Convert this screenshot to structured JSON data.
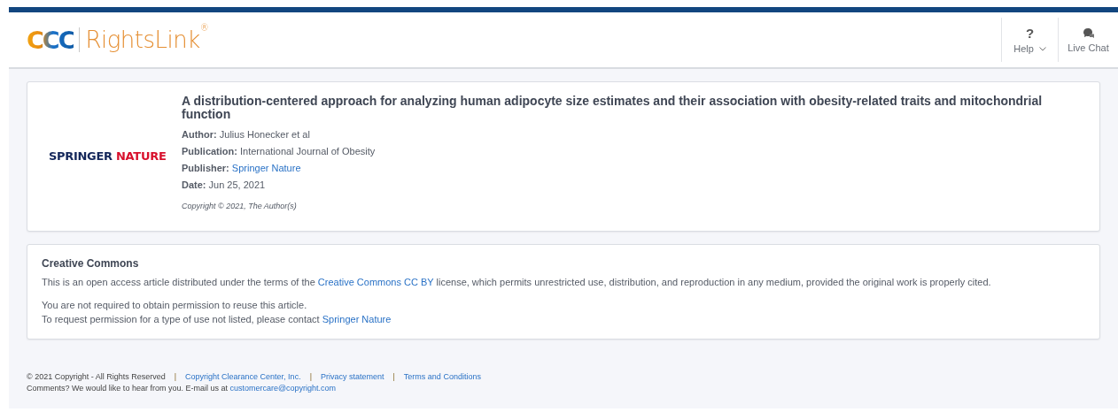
{
  "header": {
    "logo_mark": "CCC",
    "logo_text": "RightsLink",
    "logo_reg": "®",
    "actions": [
      {
        "kind": "help",
        "label": "Help",
        "icon_text": "?"
      },
      {
        "kind": "chat",
        "label": "Live Chat"
      }
    ]
  },
  "article": {
    "publisher_logo": [
      "SPRINGER",
      "NATURE"
    ],
    "title": "A distribution-centered approach for analyzing human adipocyte size estimates and their association with obesity-related traits and mitochondrial function",
    "fields": [
      {
        "label": "Author:",
        "value": "Julius Honecker et al",
        "link": false
      },
      {
        "label": "Publication:",
        "value": "International Journal of Obesity",
        "link": false
      },
      {
        "label": "Publisher:",
        "value": "Springer Nature",
        "link": true
      },
      {
        "label": "Date:",
        "value": "Jun 25, 2021",
        "link": false
      }
    ],
    "copyright": "Copyright © 2021, The Author(s)"
  },
  "license": {
    "heading": "Creative Commons",
    "paragraphs": [
      {
        "before": "This is an open access article distributed under the terms of the ",
        "link": "Creative Commons CC BY",
        "after": " license, which permits unrestricted use, distribution, and reproduction in any medium, provided the original work is properly cited."
      },
      {
        "before": "You are not required to obtain permission to reuse this article."
      },
      {
        "before": "To request permission for a type of use not listed, please contact ",
        "link": "Springer Nature"
      }
    ]
  },
  "footer": {
    "copyright": "© 2021 Copyright - All Rights Reserved",
    "links": [
      "Copyright Clearance Center, Inc.",
      "Privacy statement",
      "Terms and Conditions"
    ],
    "separator": "|",
    "comment": "Comments? We would like to hear from you. E-mail us at ",
    "email": "customercare@copyright.com"
  }
}
